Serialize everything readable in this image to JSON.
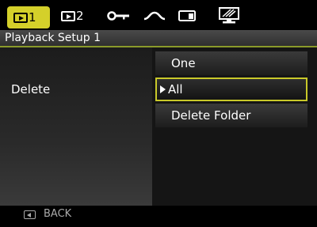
{
  "tabs": [
    {
      "icon": "playback-icon",
      "label": "1",
      "active": true
    },
    {
      "icon": "playback-icon",
      "label": "2",
      "active": false
    },
    {
      "icon": "wrench-icon",
      "label": "",
      "active": false
    },
    {
      "icon": "wave-icon",
      "label": "",
      "active": false
    },
    {
      "icon": "memory-card-icon",
      "label": "",
      "active": false
    },
    {
      "icon": "monitor-icon",
      "label": "",
      "active": false
    }
  ],
  "header": {
    "title": "Playback Setup 1"
  },
  "setting": {
    "label": "Delete"
  },
  "options": [
    {
      "label": "One",
      "selected": false
    },
    {
      "label": "All",
      "selected": true
    },
    {
      "label": "Delete Folder",
      "selected": false
    }
  ],
  "footer": {
    "back_label": "BACK",
    "back_icon": "back-button-icon"
  },
  "colors": {
    "accent": "#d4d02a",
    "selection_border": "#c9c92a",
    "header_underline": "#8a9a2a"
  }
}
